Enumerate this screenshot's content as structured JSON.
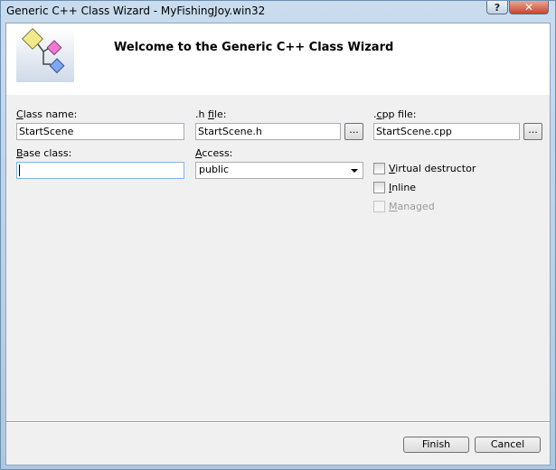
{
  "window": {
    "title": "Generic C++ Class Wizard - MyFishingJoy.win32"
  },
  "titlebar": {
    "help_glyph": "?",
    "close_glyph": "✕"
  },
  "banner": {
    "title": "Welcome to the Generic C++ Class Wizard",
    "logo_icon": "class-diagram-icon"
  },
  "form": {
    "class_name": {
      "label_key": "C",
      "label_rest": "lass name:",
      "value": "StartScene"
    },
    "h_file": {
      "label_pre": ".h ",
      "label_key": "f",
      "label_rest": "ile:",
      "value": "StartScene.h",
      "browse": "..."
    },
    "cpp_file": {
      "label_pre": ".",
      "label_key": "c",
      "label_rest": "pp file:",
      "value": "StartScene.cpp",
      "browse": "..."
    },
    "base_class": {
      "label_key": "B",
      "label_rest": "ase class:",
      "value": ""
    },
    "access": {
      "label_key": "A",
      "label_rest": "ccess:",
      "value": "public"
    },
    "virtual_destructor": {
      "label_key": "V",
      "label_rest": "irtual destructor",
      "checked": false
    },
    "inline": {
      "label_key": "I",
      "label_rest": "nline",
      "checked": false
    },
    "managed": {
      "label_key": "M",
      "label_rest": "anaged",
      "checked": false,
      "enabled": false
    }
  },
  "buttons": {
    "finish": "Finish",
    "cancel": "Cancel"
  }
}
